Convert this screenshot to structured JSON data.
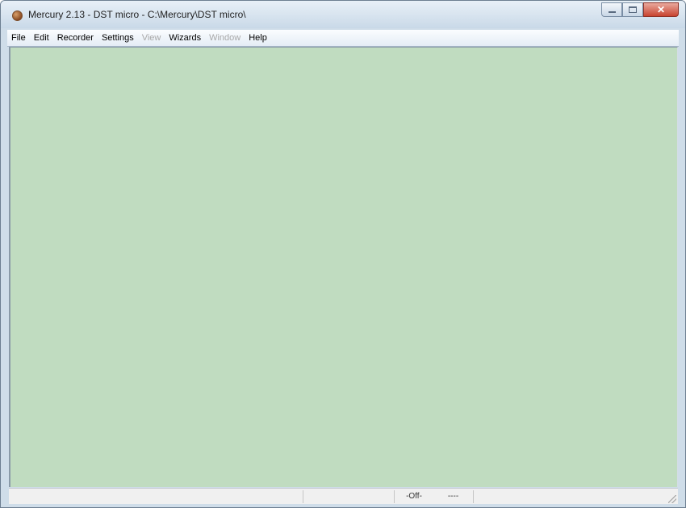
{
  "window": {
    "title": "Mercury 2.13 - DST micro - C:\\Mercury\\DST micro\\",
    "caption_buttons": {
      "minimize_icon": "minimize-icon",
      "maximize_icon": "maximize-icon",
      "close_icon": "close-icon",
      "close_glyph": "✕"
    },
    "app_icon": "mercury-app-icon"
  },
  "menu": {
    "items": [
      {
        "label": "File",
        "enabled": true
      },
      {
        "label": "Edit",
        "enabled": true
      },
      {
        "label": "Recorder",
        "enabled": true
      },
      {
        "label": "Settings",
        "enabled": true
      },
      {
        "label": "View",
        "enabled": false
      },
      {
        "label": "Wizards",
        "enabled": true
      },
      {
        "label": "Window",
        "enabled": false
      },
      {
        "label": "Help",
        "enabled": true
      }
    ]
  },
  "workspace": {
    "background_color": "#c0dcc0"
  },
  "statusbar": {
    "connection_status": "-Off-",
    "secondary_status": "----"
  }
}
